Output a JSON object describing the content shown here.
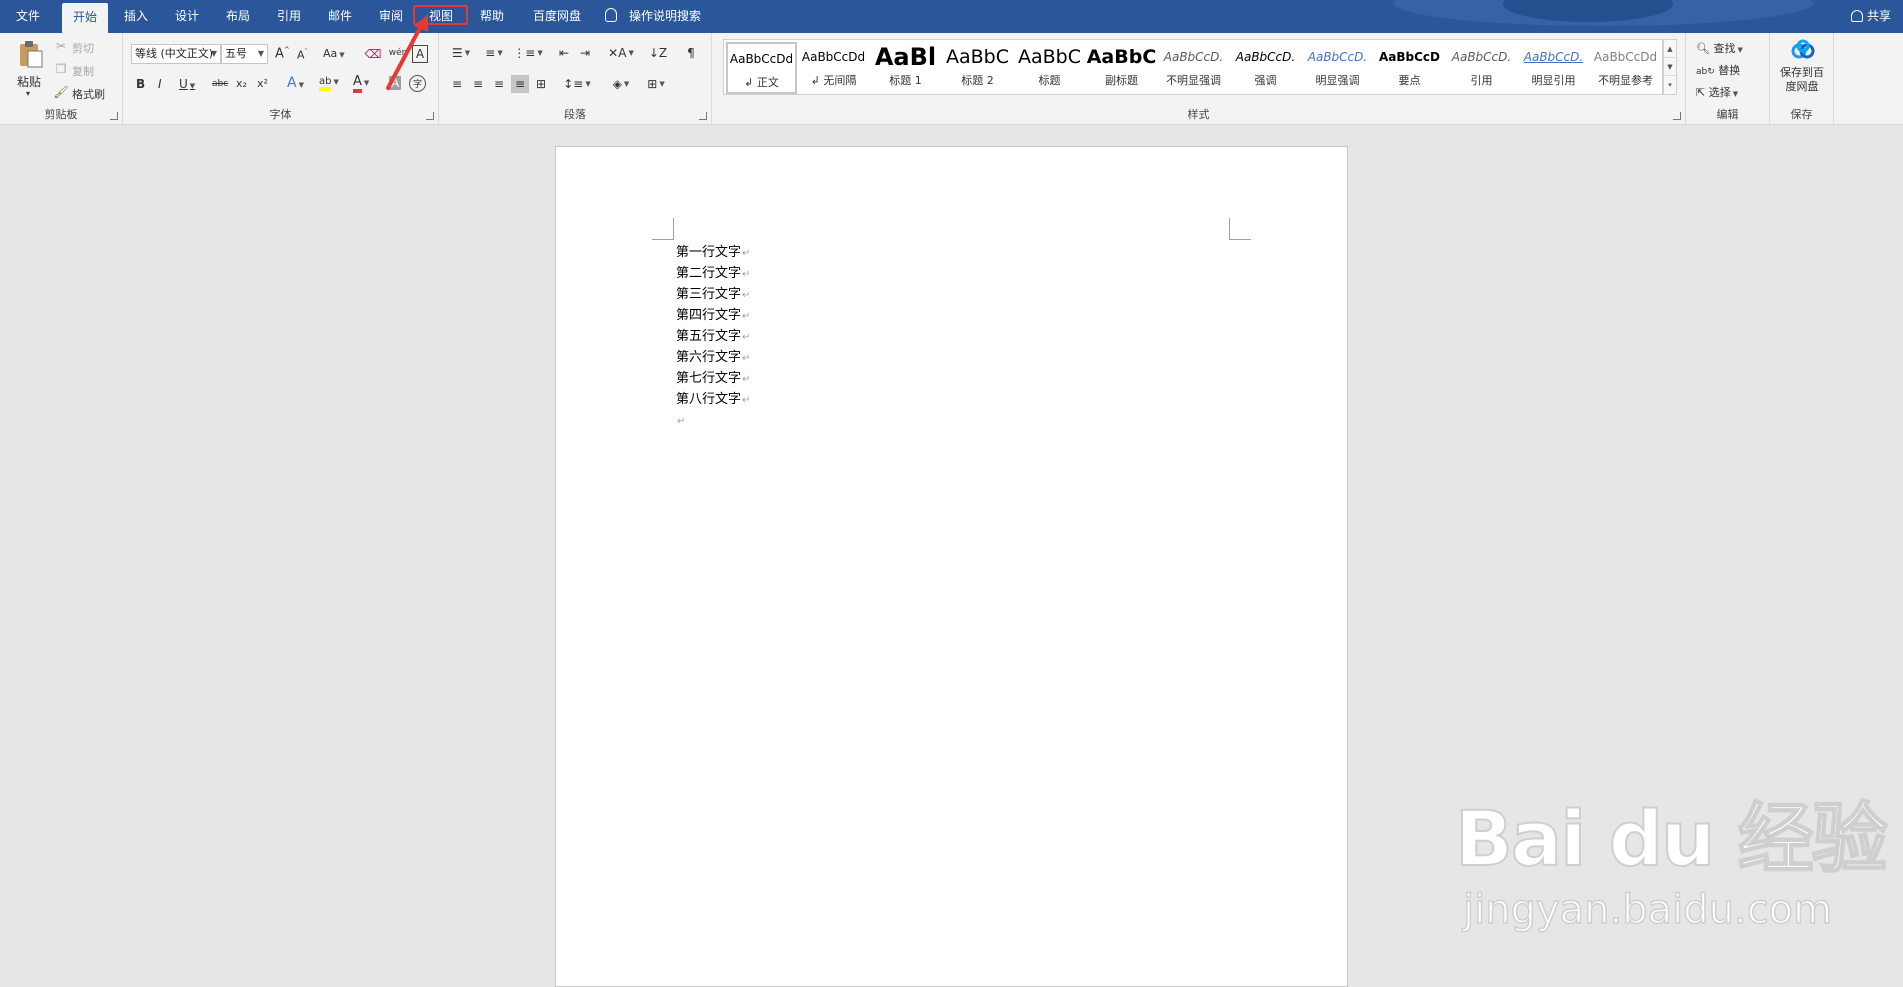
{
  "tabs": [
    {
      "label": "文件",
      "active": false
    },
    {
      "label": "开始",
      "active": true
    },
    {
      "label": "插入",
      "active": false
    },
    {
      "label": "设计",
      "active": false
    },
    {
      "label": "布局",
      "active": false
    },
    {
      "label": "引用",
      "active": false
    },
    {
      "label": "邮件",
      "active": false
    },
    {
      "label": "审阅",
      "active": false
    },
    {
      "label": "视图",
      "active": false,
      "highlighted": true
    },
    {
      "label": "帮助",
      "active": false
    },
    {
      "label": "百度网盘",
      "active": false
    }
  ],
  "tell_me": "操作说明搜索",
  "share": "共享",
  "colors": {
    "title_bar": "#2b579a",
    "ribbon": "#f3f3f3",
    "highlight_box": "#e53935",
    "canvas": "#e6e6e6"
  },
  "clipboard": {
    "paste": "粘贴",
    "cut": "剪切",
    "copy": "复制",
    "format_painter": "格式刷",
    "group_label": "剪贴板"
  },
  "font": {
    "font_name": "等线 (中文正文)",
    "font_size": "五号",
    "grow": "A",
    "shrink": "A",
    "change_case": "Aa",
    "bold": "B",
    "italic": "I",
    "underline": "U",
    "strikethrough": "abc",
    "subscript": "x₂",
    "superscript": "x²",
    "text_effects": "A",
    "font_color": "A",
    "char_shading": "A",
    "enclose": "字",
    "group_label": "字体"
  },
  "paragraph": {
    "group_label": "段落"
  },
  "styles": {
    "group_label": "样式",
    "items": [
      {
        "sample": "AaBbCcDd",
        "name": "正文",
        "selected": true
      },
      {
        "sample": "AaBbCcDd",
        "name": "无间隔"
      },
      {
        "sample": "AaBl",
        "name": "标题 1"
      },
      {
        "sample": "AaBbC",
        "name": "标题 2"
      },
      {
        "sample": "AaBbC",
        "name": "标题"
      },
      {
        "sample": "AaBbC",
        "name": "副标题"
      },
      {
        "sample": "AaBbCcD.",
        "name": "不明显强调"
      },
      {
        "sample": "AaBbCcD.",
        "name": "强调"
      },
      {
        "sample": "AaBbCcD.",
        "name": "明显强调"
      },
      {
        "sample": "AaBbCcD",
        "name": "要点"
      },
      {
        "sample": "AaBbCcD.",
        "name": "引用"
      },
      {
        "sample": "AaBbCcD.",
        "name": "明显引用"
      },
      {
        "sample": "AaBbCcDd",
        "name": "不明显参考"
      }
    ]
  },
  "editing": {
    "find": "查找",
    "replace": "替换",
    "select": "选择",
    "group_label": "编辑"
  },
  "save": {
    "button": "保存到百度网盘",
    "group_label": "保存"
  },
  "document": {
    "lines": [
      "第一行文字",
      "第二行文字",
      "第三行文字",
      "第四行文字",
      "第五行文字",
      "第六行文字",
      "第七行文字",
      "第八行文字"
    ],
    "paragraph_mark": "↵"
  },
  "watermark": {
    "main": "Bai du 经验",
    "sub": "jingyan.baidu.com"
  }
}
